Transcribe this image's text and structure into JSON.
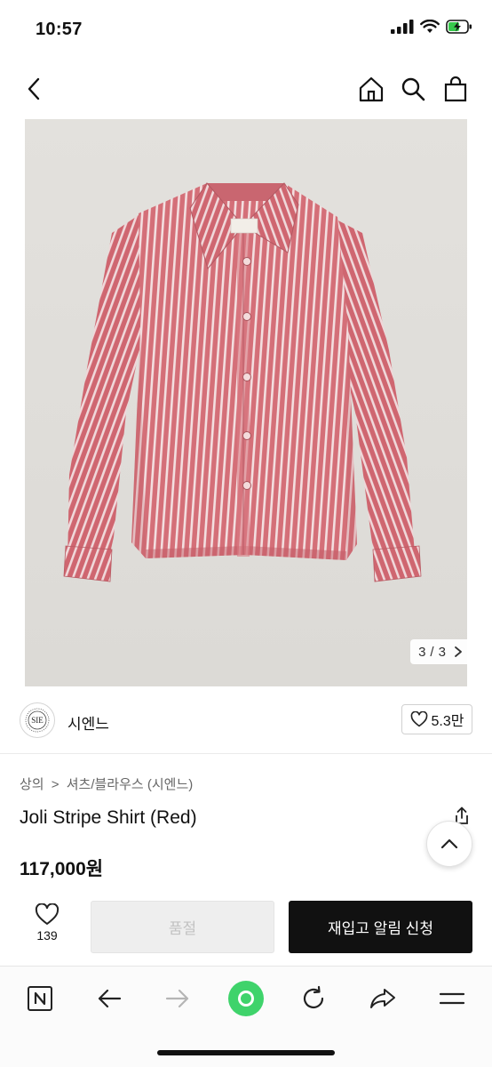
{
  "status_bar": {
    "time": "10:57"
  },
  "gallery": {
    "current": "3",
    "total": "3",
    "separator": "/"
  },
  "brand": {
    "name": "시엔느",
    "logo_text": "SIE",
    "likes": "5.3만"
  },
  "product": {
    "breadcrumb_category": "상의",
    "breadcrumb_sep": ">",
    "breadcrumb_sub": "셔츠/블라우스 (시엔느)",
    "name": "Joli Stripe Shirt (Red)",
    "price": "117,000원"
  },
  "actions": {
    "wish_count": "139",
    "soldout_label": "품절",
    "restock_label": "재입고 알림 신청"
  },
  "colors": {
    "primary_button": "#111111",
    "disabled_button": "#eeeeee",
    "browser_center": "#3fd36b",
    "shirt": "#d46f78"
  }
}
